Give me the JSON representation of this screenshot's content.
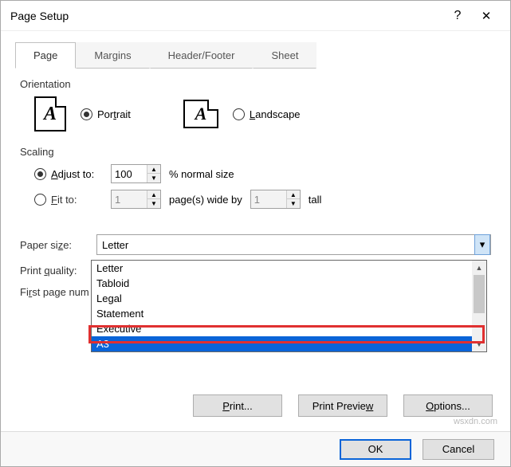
{
  "window": {
    "title": "Page Setup",
    "help_symbol": "?",
    "close_symbol": "✕"
  },
  "tabs": {
    "page": "Page",
    "margins": "Margins",
    "header_footer": "Header/Footer",
    "sheet": "Sheet"
  },
  "orientation": {
    "label": "Orientation",
    "portrait": "Portrait",
    "landscape": "Landscape",
    "icon_letter": "A"
  },
  "scaling": {
    "label": "Scaling",
    "adjust_to": "Adjust to:",
    "adjust_value": "100",
    "adjust_suffix": "% normal size",
    "fit_to": "Fit to:",
    "fit_wide_value": "1",
    "fit_wide_suffix": "page(s) wide by",
    "fit_tall_value": "1",
    "fit_tall_suffix": "tall"
  },
  "paper": {
    "label_paper_size": "Paper size:",
    "label_print_quality": "Print quality:",
    "label_first_page": "First page num",
    "selected": "Letter",
    "options": [
      "Letter",
      "Tabloid",
      "Legal",
      "Statement",
      "Executive",
      "A3"
    ],
    "highlighted_option": "A3"
  },
  "buttons": {
    "print": "Print...",
    "print_preview": "Print Preview",
    "options": "Options...",
    "ok": "OK",
    "cancel": "Cancel"
  },
  "watermark": "wsxdn.com"
}
